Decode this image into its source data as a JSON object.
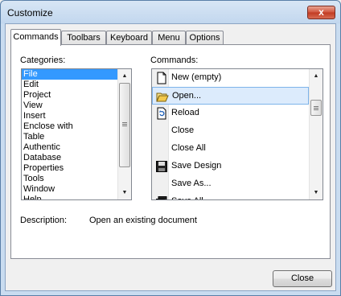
{
  "window": {
    "title": "Customize",
    "close_glyph": "x"
  },
  "tabs": [
    {
      "label": "Commands",
      "active": true
    },
    {
      "label": "Toolbars",
      "active": false
    },
    {
      "label": "Keyboard",
      "active": false
    },
    {
      "label": "Menu",
      "active": false
    },
    {
      "label": "Options",
      "active": false
    }
  ],
  "categories": {
    "label": "Categories:",
    "items": [
      "File",
      "Edit",
      "Project",
      "View",
      "Insert",
      "Enclose with",
      "Table",
      "Authentic",
      "Database",
      "Properties",
      "Tools",
      "Window",
      "Help"
    ],
    "selected": 0
  },
  "commands": {
    "label": "Commands:",
    "items": [
      {
        "label": "New (empty)",
        "icon": "new-document-icon"
      },
      {
        "label": "Open...",
        "icon": "open-folder-icon"
      },
      {
        "label": "Reload",
        "icon": "reload-icon"
      },
      {
        "label": "Close",
        "icon": ""
      },
      {
        "label": "Close All",
        "icon": ""
      },
      {
        "label": "Save Design",
        "icon": "save-disk-icon"
      },
      {
        "label": "Save As...",
        "icon": ""
      },
      {
        "label": "Save All",
        "icon": "save-all-icon"
      }
    ],
    "highlighted": 1
  },
  "description": {
    "label": "Description:",
    "text": "Open an existing document"
  },
  "buttons": {
    "close": "Close"
  },
  "colors": {
    "selection": "#3399ff",
    "hover": "#dcebfc"
  }
}
